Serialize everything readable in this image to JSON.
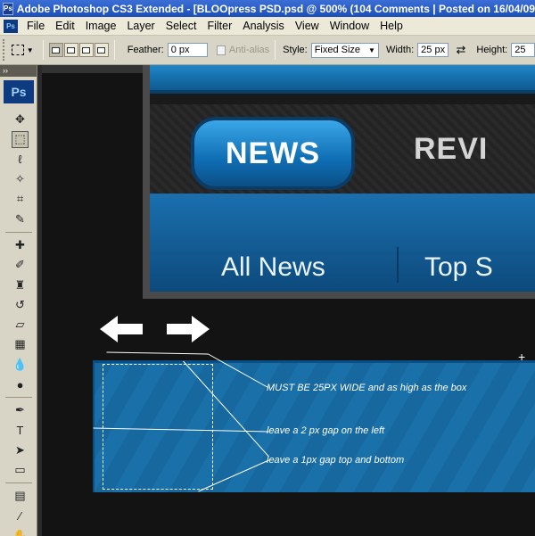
{
  "window": {
    "title": "Adobe Photoshop CS3 Extended - [BLOOpress PSD.psd @ 500% (104 Comments | Posted on 16/04/09 @ 10:3",
    "app_icon": "Ps"
  },
  "menubar": {
    "icon": "Ps",
    "items": [
      "File",
      "Edit",
      "Image",
      "Layer",
      "Select",
      "Filter",
      "Analysis",
      "View",
      "Window",
      "Help"
    ]
  },
  "options": {
    "feather_label": "Feather:",
    "feather_value": "0 px",
    "antialias_label": "Anti-alias",
    "style_label": "Style:",
    "style_value": "Fixed Size",
    "width_label": "Width:",
    "width_value": "25 px",
    "height_label": "Height:",
    "height_value": "25"
  },
  "tools": {
    "logo": "Ps",
    "items": [
      {
        "name": "move-tool",
        "glyph": "✥"
      },
      {
        "name": "rectangular-marquee-tool",
        "glyph": "⬚",
        "selected": true
      },
      {
        "name": "lasso-tool",
        "glyph": "ℓ"
      },
      {
        "name": "magic-wand-tool",
        "glyph": "✧"
      },
      {
        "name": "crop-tool",
        "glyph": "⌗"
      },
      {
        "name": "slice-tool",
        "glyph": "✎"
      },
      {
        "name": "healing-brush-tool",
        "glyph": "✚"
      },
      {
        "name": "brush-tool",
        "glyph": "✐"
      },
      {
        "name": "clone-stamp-tool",
        "glyph": "♜"
      },
      {
        "name": "history-brush-tool",
        "glyph": "↺"
      },
      {
        "name": "eraser-tool",
        "glyph": "▱"
      },
      {
        "name": "gradient-tool",
        "glyph": "▦"
      },
      {
        "name": "blur-tool",
        "glyph": "💧"
      },
      {
        "name": "dodge-tool",
        "glyph": "●"
      },
      {
        "name": "pen-tool",
        "glyph": "✒"
      },
      {
        "name": "type-tool",
        "glyph": "T"
      },
      {
        "name": "path-selection-tool",
        "glyph": "➤"
      },
      {
        "name": "rectangle-tool",
        "glyph": "▭"
      },
      {
        "name": "notes-tool",
        "glyph": "▤"
      },
      {
        "name": "eyedropper-tool",
        "glyph": "⁄"
      },
      {
        "name": "hand-tool",
        "glyph": "✋"
      }
    ]
  },
  "site": {
    "nav_active": "NEWS",
    "nav_next": "REVI",
    "sub_left": "All News",
    "sub_right": "Top S"
  },
  "annotations": {
    "note1": "MUST BE 25PX WIDE and as high as the box",
    "note2": "leave a 2 px gap on the left",
    "note3": "leave a 1px gap top and bottom"
  }
}
